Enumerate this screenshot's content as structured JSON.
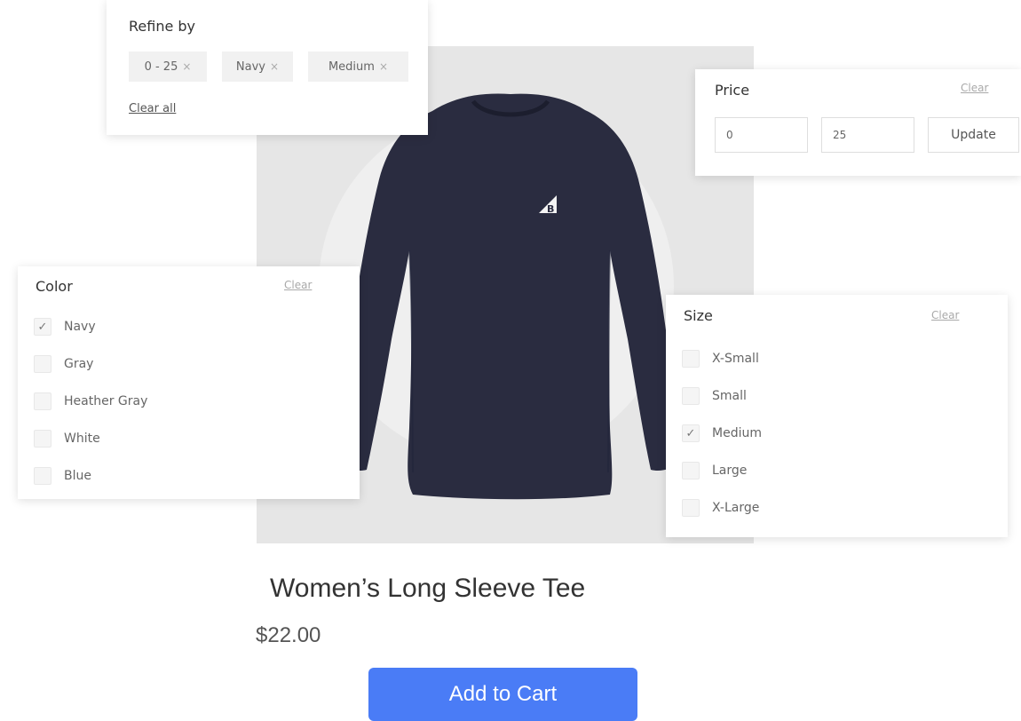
{
  "refine": {
    "title": "Refine by",
    "chips": [
      {
        "label": "0 - 25",
        "remove_icon": "×"
      },
      {
        "label": "Navy",
        "remove_icon": "×"
      },
      {
        "label": "Medium",
        "remove_icon": "×"
      }
    ],
    "clear_all": "Clear all"
  },
  "price": {
    "title": "Price",
    "clear": "Clear",
    "min_value": "0",
    "max_value": "25",
    "update_label": "Update"
  },
  "color": {
    "title": "Color",
    "clear": "Clear",
    "options": [
      {
        "label": "Navy",
        "checked": true
      },
      {
        "label": "Gray",
        "checked": false
      },
      {
        "label": "Heather Gray",
        "checked": false
      },
      {
        "label": "White",
        "checked": false
      },
      {
        "label": "Blue",
        "checked": false
      }
    ]
  },
  "size": {
    "title": "Size",
    "clear": "Clear",
    "options": [
      {
        "label": "X-Small",
        "checked": false
      },
      {
        "label": "Small",
        "checked": false
      },
      {
        "label": "Medium",
        "checked": true
      },
      {
        "label": "Large",
        "checked": false
      },
      {
        "label": "X-Large",
        "checked": false
      }
    ]
  },
  "product": {
    "name": "Women’s Long Sleeve Tee",
    "price": "$22.00",
    "add_to_cart": "Add to Cart",
    "logo_letter": "B",
    "shirt_color": "#2a2c40",
    "button_color": "#4a7cf6"
  }
}
